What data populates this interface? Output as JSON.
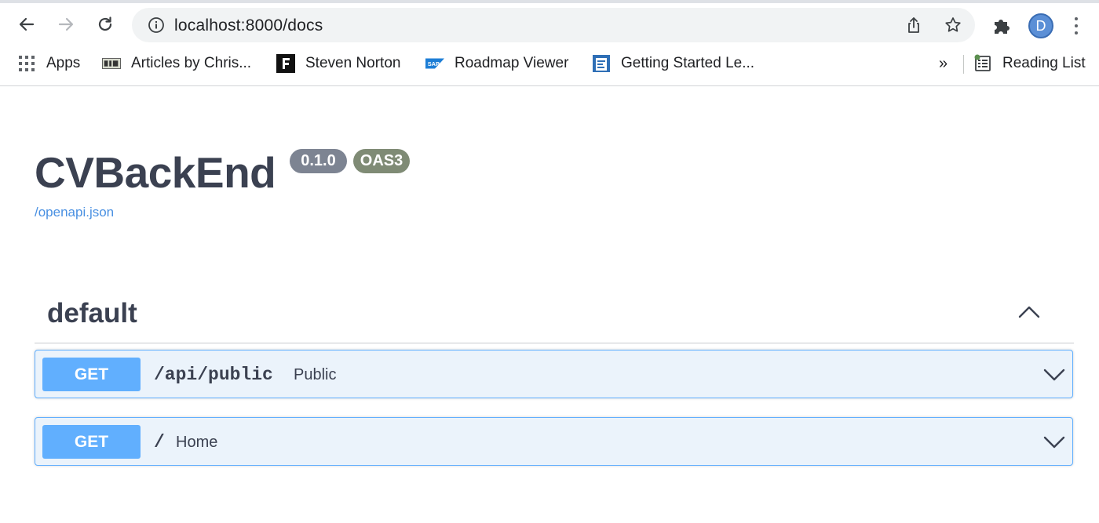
{
  "browser": {
    "url": "localhost:8000/docs",
    "avatar_letter": "D",
    "bookmarks": [
      {
        "label": "Apps",
        "icon": "apps-grid-icon"
      },
      {
        "label": "Articles by Chris...",
        "icon": "cio-icon"
      },
      {
        "label": "Steven Norton",
        "icon": "f-logo-icon"
      },
      {
        "label": "Roadmap Viewer",
        "icon": "sap-logo-icon"
      },
      {
        "label": "Getting Started Le...",
        "icon": "doc-page-icon"
      }
    ],
    "more_label": "»",
    "reading_list_label": "Reading List"
  },
  "info": {
    "title": "CVBackEnd",
    "version_badge": "0.1.0",
    "oas_badge": "OAS3",
    "spec_link": "/openapi.json"
  },
  "tag": {
    "name": "default",
    "expanded": true
  },
  "operations": [
    {
      "method": "GET",
      "path": "/api/public",
      "summary": "Public"
    },
    {
      "method": "GET",
      "path": "/",
      "summary": "Home"
    }
  ],
  "colors": {
    "get_method": "#61affe",
    "get_block_bg": "#ebf3fb",
    "title_text": "#3b4151",
    "link": "#4990e2",
    "badge_version": "#7d8492",
    "badge_oas": "#7f8b75"
  }
}
